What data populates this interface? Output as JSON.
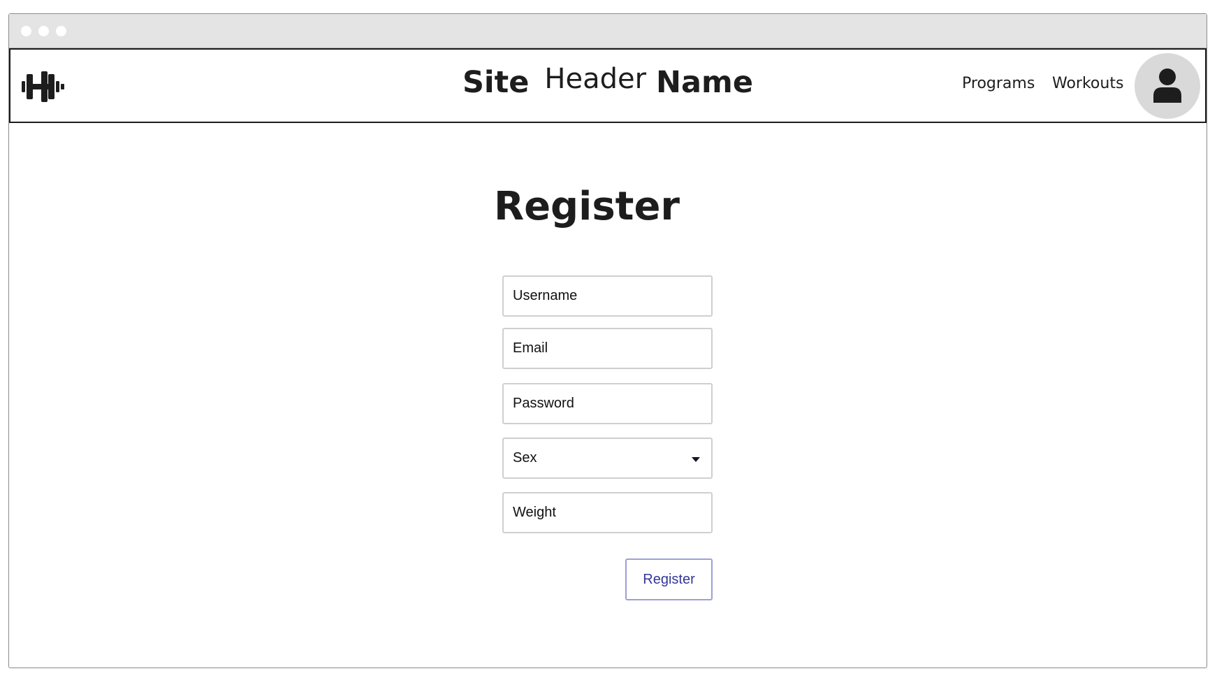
{
  "window": {
    "controls": [
      "window-dot",
      "window-dot",
      "window-dot"
    ]
  },
  "header": {
    "logo_icon": "dumbbell-icon",
    "title_part1": "Site",
    "title_part2": "Header",
    "title_part3": "Name",
    "nav": [
      {
        "label": "Programs"
      },
      {
        "label": "Workouts"
      }
    ],
    "avatar_icon": "user-icon"
  },
  "main": {
    "heading": "Register",
    "form": {
      "username_placeholder": "Username",
      "email_placeholder": "Email",
      "password_placeholder": "Password",
      "sex_selected": "Sex",
      "weight_placeholder": "Weight",
      "submit_label": "Register"
    }
  },
  "colors": {
    "text": "#1d1d1d",
    "titlebar": "#e4e4e4",
    "field_border": "#cfcfcf",
    "button_border": "#9d9fd6",
    "button_text": "#33369a",
    "avatar_bg": "#d9d9d9"
  }
}
